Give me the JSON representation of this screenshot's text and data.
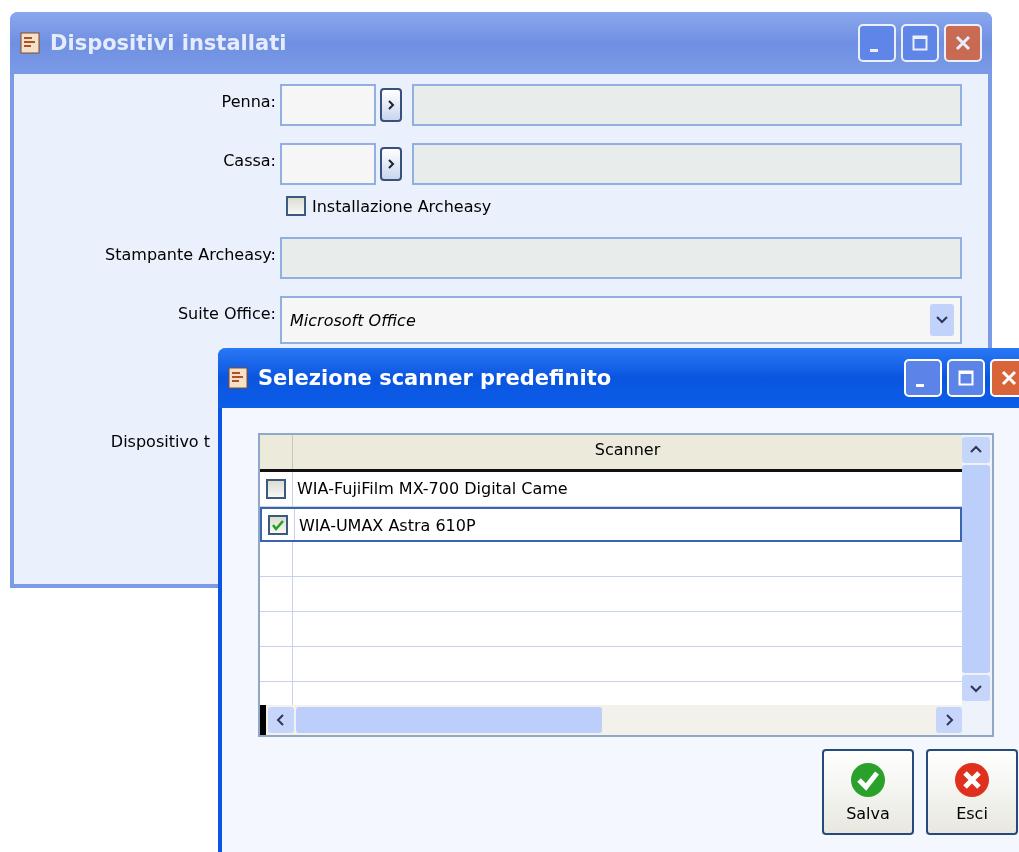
{
  "main_window": {
    "title": "Dispositivi installati",
    "fields": [
      {
        "kind": "lookup",
        "label": "Penna:"
      },
      {
        "kind": "lookup",
        "label": "Cassa:"
      },
      {
        "kind": "checkbox",
        "label": "Installazione Archeasy",
        "checked": false
      },
      {
        "kind": "text",
        "label": "Stampante Archeasy:"
      },
      {
        "kind": "combo",
        "label": "Suite Office:",
        "value": "Microsoft Office"
      },
      {
        "kind": "label",
        "label": "Dispositivo t"
      }
    ]
  },
  "dialog": {
    "title": "Selezione scanner predefinito",
    "table": {
      "columns": [
        "Scanner"
      ],
      "rows": [
        {
          "name": "WIA-FujiFilm MX-700 Digital Came",
          "checked": false,
          "selected": false
        },
        {
          "name": "WIA-UMAX Astra 610P",
          "checked": true,
          "selected": true
        }
      ]
    },
    "buttons": [
      {
        "kind": "save",
        "label": "Salva"
      },
      {
        "kind": "exit",
        "label": "Esci"
      }
    ]
  }
}
